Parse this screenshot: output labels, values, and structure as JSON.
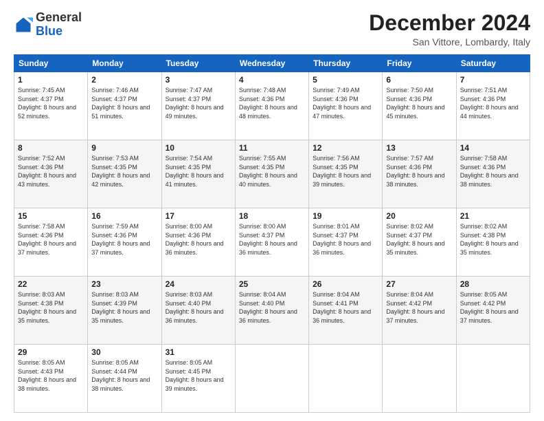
{
  "header": {
    "logo": {
      "general": "General",
      "blue": "Blue"
    },
    "title": "December 2024",
    "location": "San Vittore, Lombardy, Italy"
  },
  "calendar": {
    "days_of_week": [
      "Sunday",
      "Monday",
      "Tuesday",
      "Wednesday",
      "Thursday",
      "Friday",
      "Saturday"
    ],
    "weeks": [
      [
        {
          "day": "1",
          "sunrise": "Sunrise: 7:45 AM",
          "sunset": "Sunset: 4:37 PM",
          "daylight": "Daylight: 8 hours and 52 minutes."
        },
        {
          "day": "2",
          "sunrise": "Sunrise: 7:46 AM",
          "sunset": "Sunset: 4:37 PM",
          "daylight": "Daylight: 8 hours and 51 minutes."
        },
        {
          "day": "3",
          "sunrise": "Sunrise: 7:47 AM",
          "sunset": "Sunset: 4:37 PM",
          "daylight": "Daylight: 8 hours and 49 minutes."
        },
        {
          "day": "4",
          "sunrise": "Sunrise: 7:48 AM",
          "sunset": "Sunset: 4:36 PM",
          "daylight": "Daylight: 8 hours and 48 minutes."
        },
        {
          "day": "5",
          "sunrise": "Sunrise: 7:49 AM",
          "sunset": "Sunset: 4:36 PM",
          "daylight": "Daylight: 8 hours and 47 minutes."
        },
        {
          "day": "6",
          "sunrise": "Sunrise: 7:50 AM",
          "sunset": "Sunset: 4:36 PM",
          "daylight": "Daylight: 8 hours and 45 minutes."
        },
        {
          "day": "7",
          "sunrise": "Sunrise: 7:51 AM",
          "sunset": "Sunset: 4:36 PM",
          "daylight": "Daylight: 8 hours and 44 minutes."
        }
      ],
      [
        {
          "day": "8",
          "sunrise": "Sunrise: 7:52 AM",
          "sunset": "Sunset: 4:36 PM",
          "daylight": "Daylight: 8 hours and 43 minutes."
        },
        {
          "day": "9",
          "sunrise": "Sunrise: 7:53 AM",
          "sunset": "Sunset: 4:35 PM",
          "daylight": "Daylight: 8 hours and 42 minutes."
        },
        {
          "day": "10",
          "sunrise": "Sunrise: 7:54 AM",
          "sunset": "Sunset: 4:35 PM",
          "daylight": "Daylight: 8 hours and 41 minutes."
        },
        {
          "day": "11",
          "sunrise": "Sunrise: 7:55 AM",
          "sunset": "Sunset: 4:35 PM",
          "daylight": "Daylight: 8 hours and 40 minutes."
        },
        {
          "day": "12",
          "sunrise": "Sunrise: 7:56 AM",
          "sunset": "Sunset: 4:35 PM",
          "daylight": "Daylight: 8 hours and 39 minutes."
        },
        {
          "day": "13",
          "sunrise": "Sunrise: 7:57 AM",
          "sunset": "Sunset: 4:36 PM",
          "daylight": "Daylight: 8 hours and 38 minutes."
        },
        {
          "day": "14",
          "sunrise": "Sunrise: 7:58 AM",
          "sunset": "Sunset: 4:36 PM",
          "daylight": "Daylight: 8 hours and 38 minutes."
        }
      ],
      [
        {
          "day": "15",
          "sunrise": "Sunrise: 7:58 AM",
          "sunset": "Sunset: 4:36 PM",
          "daylight": "Daylight: 8 hours and 37 minutes."
        },
        {
          "day": "16",
          "sunrise": "Sunrise: 7:59 AM",
          "sunset": "Sunset: 4:36 PM",
          "daylight": "Daylight: 8 hours and 37 minutes."
        },
        {
          "day": "17",
          "sunrise": "Sunrise: 8:00 AM",
          "sunset": "Sunset: 4:36 PM",
          "daylight": "Daylight: 8 hours and 36 minutes."
        },
        {
          "day": "18",
          "sunrise": "Sunrise: 8:00 AM",
          "sunset": "Sunset: 4:37 PM",
          "daylight": "Daylight: 8 hours and 36 minutes."
        },
        {
          "day": "19",
          "sunrise": "Sunrise: 8:01 AM",
          "sunset": "Sunset: 4:37 PM",
          "daylight": "Daylight: 8 hours and 36 minutes."
        },
        {
          "day": "20",
          "sunrise": "Sunrise: 8:02 AM",
          "sunset": "Sunset: 4:37 PM",
          "daylight": "Daylight: 8 hours and 35 minutes."
        },
        {
          "day": "21",
          "sunrise": "Sunrise: 8:02 AM",
          "sunset": "Sunset: 4:38 PM",
          "daylight": "Daylight: 8 hours and 35 minutes."
        }
      ],
      [
        {
          "day": "22",
          "sunrise": "Sunrise: 8:03 AM",
          "sunset": "Sunset: 4:38 PM",
          "daylight": "Daylight: 8 hours and 35 minutes."
        },
        {
          "day": "23",
          "sunrise": "Sunrise: 8:03 AM",
          "sunset": "Sunset: 4:39 PM",
          "daylight": "Daylight: 8 hours and 35 minutes."
        },
        {
          "day": "24",
          "sunrise": "Sunrise: 8:03 AM",
          "sunset": "Sunset: 4:40 PM",
          "daylight": "Daylight: 8 hours and 36 minutes."
        },
        {
          "day": "25",
          "sunrise": "Sunrise: 8:04 AM",
          "sunset": "Sunset: 4:40 PM",
          "daylight": "Daylight: 8 hours and 36 minutes."
        },
        {
          "day": "26",
          "sunrise": "Sunrise: 8:04 AM",
          "sunset": "Sunset: 4:41 PM",
          "daylight": "Daylight: 8 hours and 36 minutes."
        },
        {
          "day": "27",
          "sunrise": "Sunrise: 8:04 AM",
          "sunset": "Sunset: 4:42 PM",
          "daylight": "Daylight: 8 hours and 37 minutes."
        },
        {
          "day": "28",
          "sunrise": "Sunrise: 8:05 AM",
          "sunset": "Sunset: 4:42 PM",
          "daylight": "Daylight: 8 hours and 37 minutes."
        }
      ],
      [
        {
          "day": "29",
          "sunrise": "Sunrise: 8:05 AM",
          "sunset": "Sunset: 4:43 PM",
          "daylight": "Daylight: 8 hours and 38 minutes."
        },
        {
          "day": "30",
          "sunrise": "Sunrise: 8:05 AM",
          "sunset": "Sunset: 4:44 PM",
          "daylight": "Daylight: 8 hours and 38 minutes."
        },
        {
          "day": "31",
          "sunrise": "Sunrise: 8:05 AM",
          "sunset": "Sunset: 4:45 PM",
          "daylight": "Daylight: 8 hours and 39 minutes."
        },
        null,
        null,
        null,
        null
      ]
    ]
  }
}
